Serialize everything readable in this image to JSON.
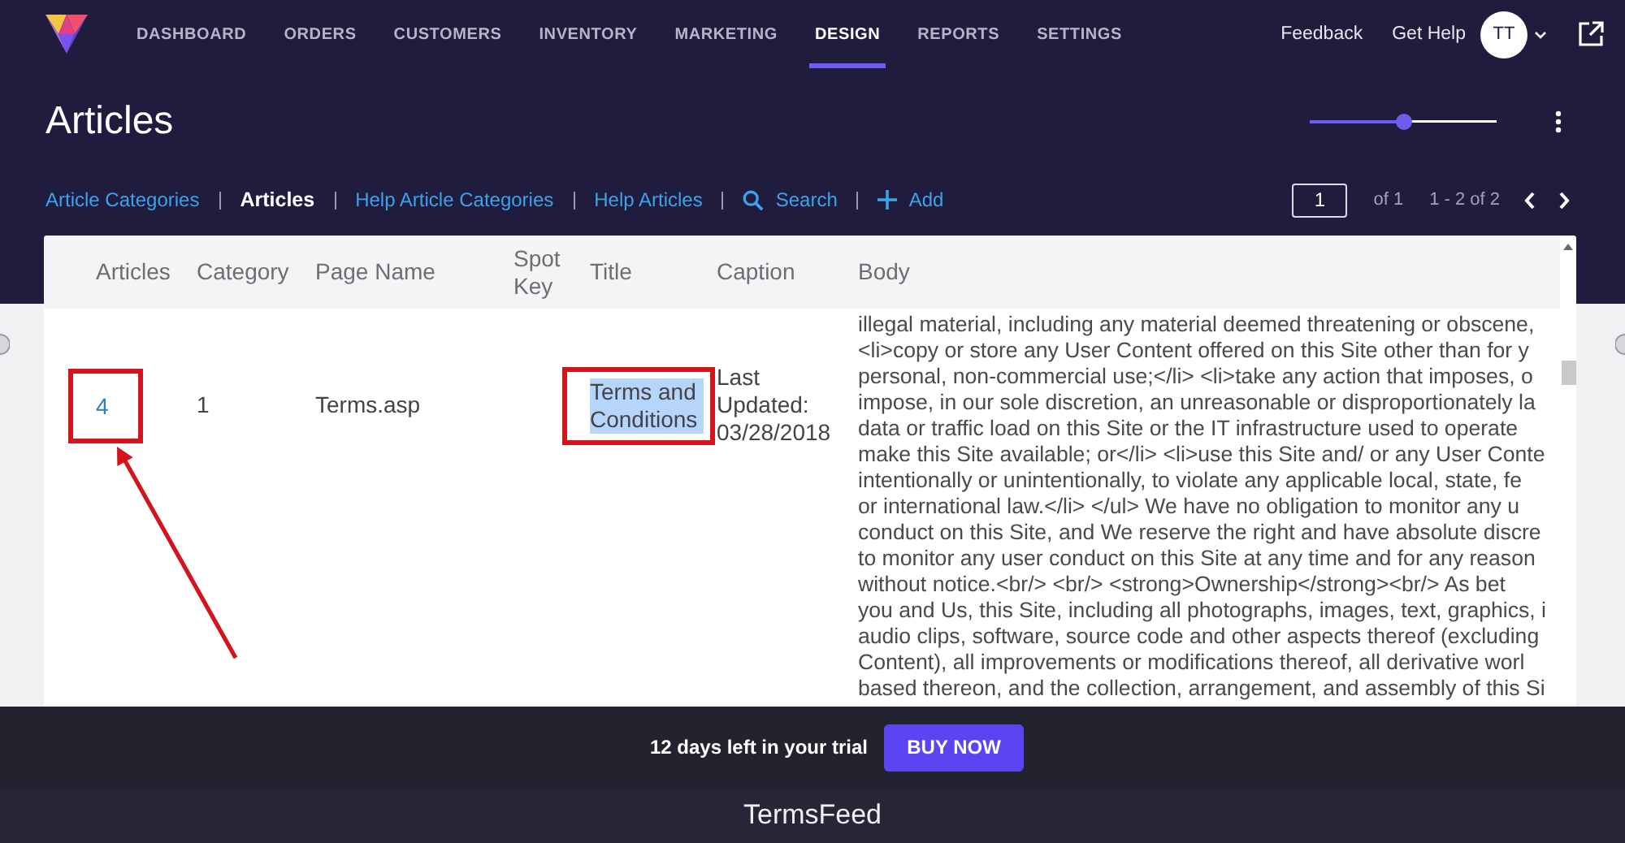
{
  "nav": {
    "items": [
      {
        "label": "DASHBOARD",
        "selected": false
      },
      {
        "label": "ORDERS",
        "selected": false
      },
      {
        "label": "CUSTOMERS",
        "selected": false
      },
      {
        "label": "INVENTORY",
        "selected": false
      },
      {
        "label": "MARKETING",
        "selected": false
      },
      {
        "label": "DESIGN",
        "selected": true
      },
      {
        "label": "REPORTS",
        "selected": false
      },
      {
        "label": "SETTINGS",
        "selected": false
      }
    ],
    "links": [
      "Feedback",
      "Get Help"
    ],
    "avatar": "TT"
  },
  "page": {
    "title": "Articles",
    "zoom_slider": {
      "level": 0.5
    }
  },
  "subnav": {
    "items": [
      {
        "label": "Article Categories",
        "selected": false
      },
      {
        "label": "Articles",
        "selected": true
      },
      {
        "label": "Help Article Categories",
        "selected": false
      },
      {
        "label": "Help Articles",
        "selected": false
      }
    ],
    "actions": [
      {
        "kind": "search",
        "label": "Search"
      },
      {
        "kind": "add",
        "label": "Add"
      }
    ]
  },
  "pager": {
    "page": "1",
    "of": "of 1",
    "range": "1 - 2 of 2"
  },
  "table": {
    "columns": [
      "Articles",
      "Category",
      "Page Name",
      "Spot Key",
      "Title",
      "Caption",
      "Body"
    ],
    "rows": [
      {
        "cells": [
          {
            "kind": "link",
            "text": "4",
            "boxed": true,
            "highlighted": false
          },
          {
            "kind": "text",
            "text": "1",
            "boxed": false,
            "highlighted": false
          },
          {
            "kind": "text",
            "text": "Terms.asp",
            "boxed": false,
            "highlighted": false
          },
          {
            "kind": "empty"
          },
          {
            "kind": "text",
            "text": "Terms and Conditions",
            "boxed": true,
            "highlighted": true
          },
          {
            "kind": "text",
            "text": "Last Updated: 03/28/2018",
            "boxed": false,
            "highlighted": false
          },
          {
            "kind": "lines",
            "lines": [
              "illegal material, including any material deemed threatening or obscene,",
              "<li>copy or store any User Content offered on this Site other than for y",
              "personal, non-commercial use;</li> <li>take any action that imposes, o",
              "impose, in our sole discretion, an unreasonable or disproportionately la",
              "data or traffic load on this Site or the IT infrastructure used to operate",
              "make this Site available; or</li> <li>use this Site and/ or any User Conte",
              "intentionally or unintentionally, to violate any applicable local, state, fe",
              "or international law.</li> </ul> We have no obligation to monitor any u",
              "conduct on this Site, and We reserve the right and have absolute discre",
              "to monitor any user conduct on this Site at any time and for any reason",
              "without notice.<br/> <br/> <strong>Ownership</strong><br/> As bet",
              "you and Us, this Site, including all photographs, images, text, graphics, i",
              "audio clips, software, source code and other aspects thereof (excluding",
              "Content), all improvements or modifications thereof, all derivative worl",
              "based thereon, and the collection, arrangement, and assembly of this Si"
            ],
            "boxed": false,
            "highlighted": false
          }
        ]
      }
    ],
    "annotation_arrow": true
  },
  "trial": {
    "message": "12 days left in your trial",
    "button": "BUY NOW"
  },
  "caption": "TermsFeed"
}
